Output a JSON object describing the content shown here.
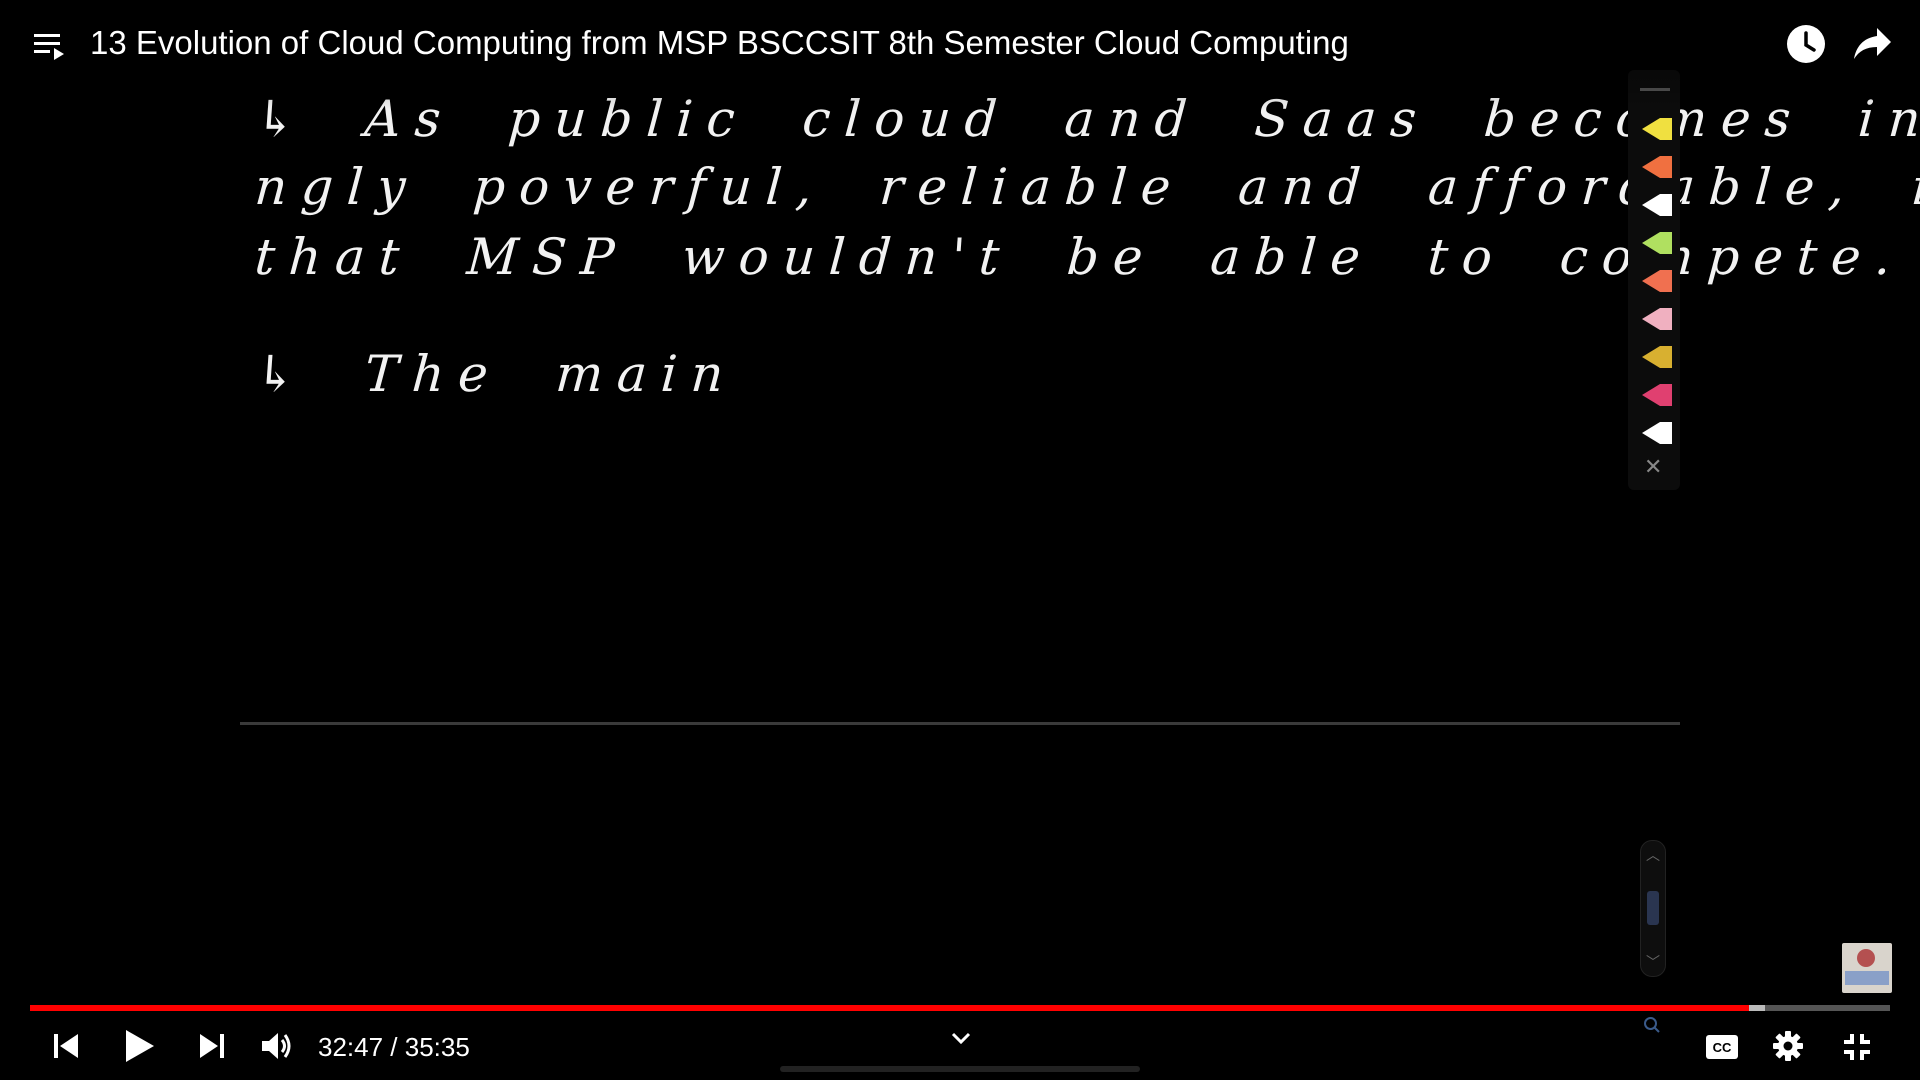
{
  "title": "13 Evolution of Cloud Computing from MSP BSCCSIT 8th Semester Cloud Computing",
  "handwriting": {
    "line1": "↳ As public cloud and Saas becomes increasi-",
    "line2": "ngly poverful, reliable and affordable, it appeared",
    "line3": "that MSP wouldn't be able to compete.",
    "line4": "↳ The main"
  },
  "player": {
    "current_time": "32:47",
    "separator": " / ",
    "duration": "35:35",
    "progress_fraction": 0.924,
    "buffer_fraction": 0.933
  },
  "pen_colors": [
    "#f0e040",
    "#f07040",
    "#ffffff",
    "#b0e060",
    "#f07050",
    "#f0b0c0",
    "#d8b030",
    "#e04070",
    "#ffffff"
  ],
  "icons": {
    "playlist": "playlist-icon",
    "watch_later": "clock-icon",
    "share": "share-arrow-icon",
    "previous": "skip-previous-icon",
    "play": "play-icon",
    "next": "skip-next-icon",
    "volume": "volume-icon",
    "captions": "cc-icon",
    "settings": "gear-icon",
    "exit_fullscreen": "exit-fullscreen-icon"
  }
}
